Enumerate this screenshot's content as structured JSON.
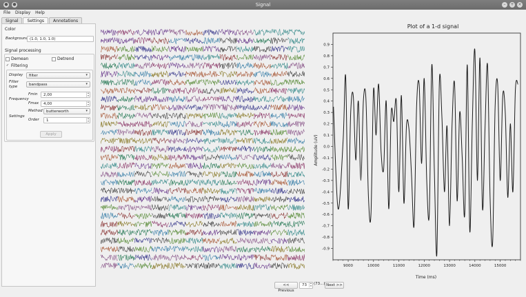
{
  "window": {
    "title": "Signal"
  },
  "menu": [
    "File",
    "Display",
    "Help"
  ],
  "tabs": [
    "Signal",
    "Settings",
    "Annotations"
  ],
  "settings": {
    "color_section": "Color",
    "background_label": "Background",
    "background_value": "(1.0, 1.0, 1.0)",
    "processing_section": "Signal processing",
    "demean_label": "Demean",
    "detrend_label": "Detrend",
    "filtering_label": "Filtering",
    "filtering_checked": true,
    "display_label": "Display",
    "display_value": "filter",
    "filter_type_label": "Filter type",
    "filter_type_value": "bandpass",
    "frequency_label": "Frequency",
    "fmin_label": "Fmin",
    "fmin_value": "2,00",
    "fmax_label": "Fmax",
    "fmax_value": "4,00",
    "settings_label": "Settings",
    "method_label": "Method",
    "method_value": "butterworth",
    "order_label": "Order",
    "order_value": "1",
    "apply_label": "Apply"
  },
  "channels": {
    "count": 29
  },
  "navigation": {
    "previous_label": "<< Previous",
    "index_value": "73",
    "index_suffix": "(73...)",
    "next_label": "Next >>"
  },
  "chart_data": {
    "type": "line",
    "title": "Plot of a 1-d signal",
    "xlabel": "Time (ms)",
    "ylabel": "Amplitude (uV)",
    "xlim": [
      8400,
      15800
    ],
    "ylim": [
      -1.0,
      1.0
    ],
    "xticks": [
      9000,
      10000,
      11000,
      12000,
      13000,
      14000,
      15000
    ],
    "yticks": [
      -0.9,
      -0.8,
      -0.7,
      -0.6,
      -0.5,
      -0.4,
      -0.3,
      -0.2,
      -0.1,
      0.0,
      0.1,
      0.2,
      0.3,
      0.4,
      0.5,
      0.6,
      0.7,
      0.8,
      0.9
    ],
    "series": [
      {
        "x": [
          8420,
          8600,
          8800,
          8900,
          9000,
          9100,
          9200,
          9300,
          9400,
          9500,
          9600,
          9700,
          9800,
          9900,
          10000,
          10100,
          10200,
          10300,
          10400,
          10500,
          10600,
          10700,
          10800,
          10900,
          11000,
          11100,
          11200,
          11300,
          11400,
          11500,
          11600,
          11700,
          11800,
          11900,
          12000,
          12100,
          12200,
          12300,
          12400,
          12500,
          12600,
          12700,
          12800,
          12900,
          13000,
          13100,
          13200,
          13300,
          13400,
          13500,
          13600,
          13700,
          13800,
          13900,
          14000,
          14100,
          14200,
          14300,
          14400,
          14500,
          14600,
          14700,
          14800,
          14900,
          15000,
          15100,
          15200,
          15300,
          15400,
          15500,
          15600,
          15700
        ],
        "y": [
          0.35,
          -0.55,
          0.05,
          0.62,
          -0.55,
          0.3,
          0.45,
          -0.12,
          0.4,
          -0.3,
          0.4,
          0.42,
          -0.45,
          -0.6,
          0.5,
          0.1,
          0.55,
          -0.05,
          -0.2,
          0.4,
          -0.55,
          0.3,
          0.22,
          0.4,
          -0.4,
          0.45,
          -0.5,
          0.18,
          0.15,
          -0.25,
          -0.7,
          0.35,
          0.55,
          -0.15,
          0.6,
          -0.3,
          -0.6,
          0.72,
          -0.2,
          -0.95,
          0.58,
          0.25,
          -0.4,
          0.18,
          -0.7,
          0.2,
          0.55,
          -0.48,
          0.3,
          -0.1,
          -0.6,
          0.72,
          -0.75,
          0.22,
          0.85,
          -0.3,
          0.78,
          -0.55,
          0.15,
          0.72,
          -0.45,
          -0.85,
          0.35,
          0.55,
          -0.3,
          0.45,
          0.3,
          -0.45,
          0.2,
          -0.4,
          0.5,
          0.55
        ]
      }
    ]
  }
}
